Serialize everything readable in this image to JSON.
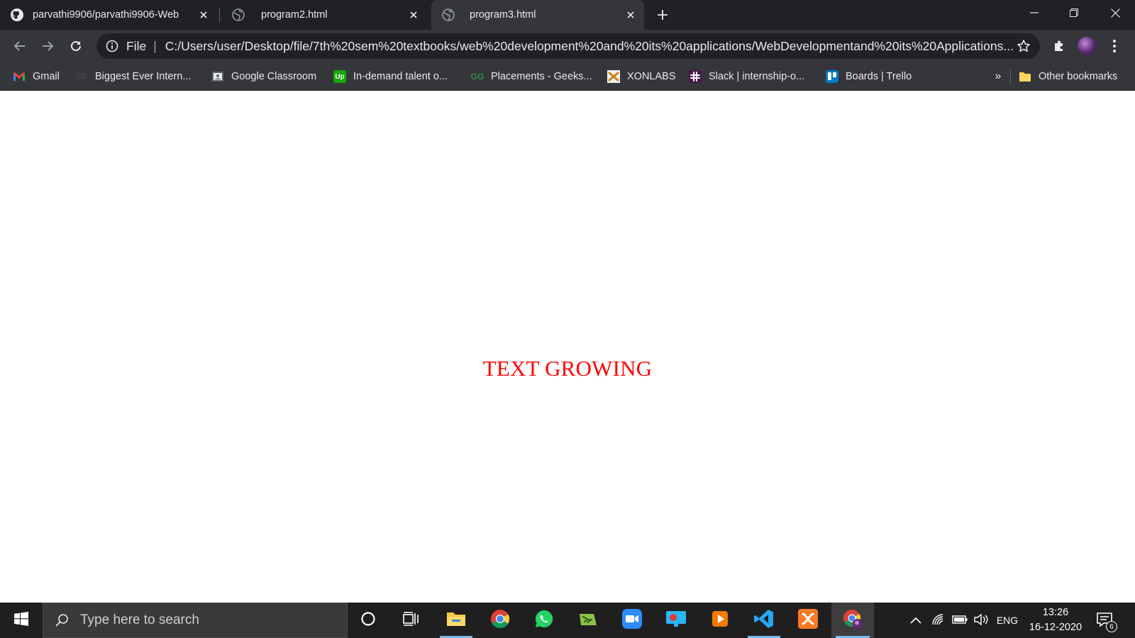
{
  "tabs": [
    {
      "title": "parvathi9906/parvathi9906-Web",
      "icon": "github-icon",
      "active": false
    },
    {
      "title": "program2.html",
      "icon": "globe-icon",
      "active": false
    },
    {
      "title": "program3.html",
      "icon": "globe-icon",
      "active": true
    }
  ],
  "omnibox": {
    "scheme": "File",
    "url": "C:/Users/user/Desktop/file/7th%20sem%20textbooks/web%20development%20and%20its%20applications/WebDevelopmentand%20its%20Applications..."
  },
  "bookmarks": [
    {
      "label": "Gmail",
      "icon": "gmail-icon"
    },
    {
      "label": "Biggest Ever Intern...",
      "icon": "sb-icon"
    },
    {
      "label": "Google Classroom",
      "icon": "classroom-icon"
    },
    {
      "label": "In-demand talent o...",
      "icon": "upwork-icon"
    },
    {
      "label": "Placements - Geeks...",
      "icon": "geeksforgeeks-icon"
    },
    {
      "label": "XONLABS",
      "icon": "xonlabs-icon"
    },
    {
      "label": "Slack | internship-o...",
      "icon": "slack-icon"
    },
    {
      "label": "Boards | Trello",
      "icon": "trello-icon"
    }
  ],
  "bookmarks_overflow": "»",
  "other_bookmarks": "Other bookmarks",
  "page": {
    "text": "TEXT GROWING",
    "text_color": "#ff0000"
  },
  "taskbar": {
    "search_placeholder": "Type here to search",
    "apps": [
      "cortana",
      "task-view",
      "file-explorer",
      "chrome",
      "whatsapp",
      "notepad-plus-plus",
      "zoom",
      "screen-recorder",
      "media-player",
      "vscode",
      "xampp",
      "chrome-profile"
    ],
    "language": "ENG",
    "time": "13:26",
    "date": "16-12-2020",
    "notification_count": "6"
  },
  "colors": {
    "tabstrip": "#202124",
    "toolbar": "#35363a",
    "taskbar": "#1f1f1f",
    "accent": "#76b9ed"
  }
}
